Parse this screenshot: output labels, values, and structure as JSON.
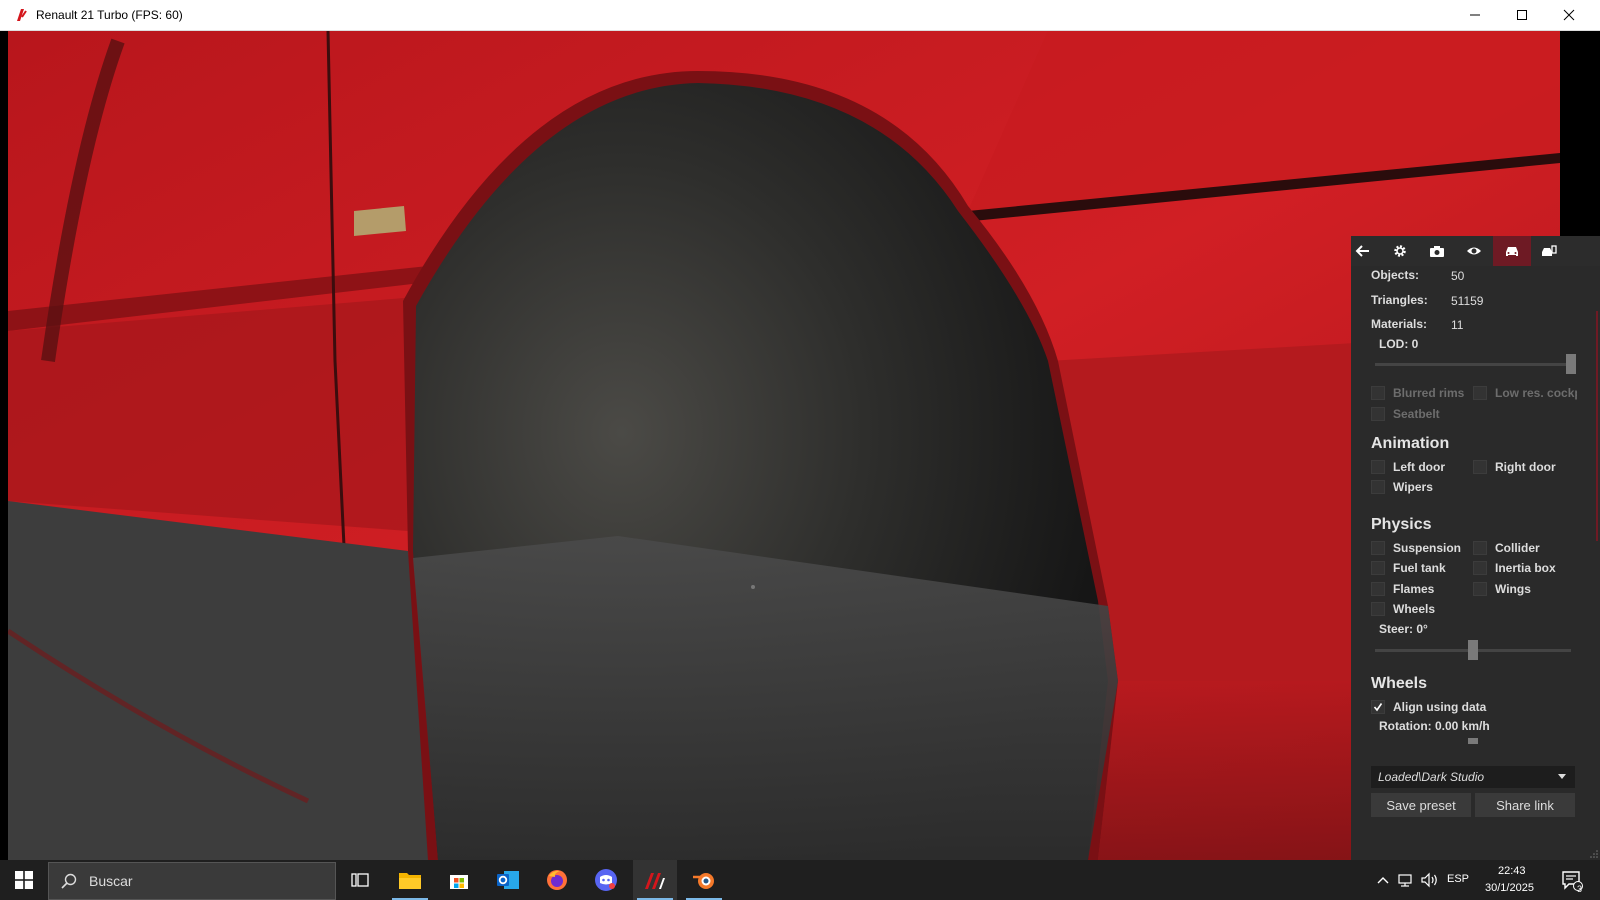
{
  "window": {
    "title": "Renault 21 Turbo (FPS: 60)",
    "controls": [
      "minimize",
      "maximize",
      "close"
    ]
  },
  "panel": {
    "tabs": [
      "back-arrow-icon",
      "gear-icon",
      "camera-icon",
      "eye-icon",
      "car-icon",
      "car-info-icon"
    ],
    "active_tab": "car-icon",
    "stats": [
      {
        "label": "Objects:",
        "value": "50"
      },
      {
        "label": "Triangles:",
        "value": "51159"
      },
      {
        "label": "Materials:",
        "value": "11"
      }
    ],
    "lod_label": "LOD: 0",
    "options": {
      "blurred_rims": "Blurred rims",
      "low_res_cockpit": "Low res. cockp",
      "seatbelt": "Seatbelt"
    },
    "animation": {
      "title": "Animation",
      "left_door": "Left door",
      "right_door": "Right door",
      "wipers": "Wipers"
    },
    "physics": {
      "title": "Physics",
      "suspension": "Suspension",
      "collider": "Collider",
      "fuel_tank": "Fuel tank",
      "inertia_box": "Inertia box",
      "flames": "Flames",
      "wings": "Wings",
      "wheels": "Wheels",
      "steer_label": "Steer: 0°"
    },
    "wheels": {
      "title": "Wheels",
      "align_using_data": "Align using data",
      "rotation_label": "Rotation: 0.00 km/h",
      "align_checked": true
    },
    "preset": {
      "selected": "Loaded\\Dark Studio"
    },
    "buttons": {
      "save": "Save preset",
      "share": "Share link"
    }
  },
  "taskbar": {
    "search_placeholder": "Buscar",
    "apps": [
      "task-view-icon",
      "file-explorer-icon",
      "microsoft-store-icon",
      "outlook-icon",
      "firefox-icon",
      "discord-icon",
      "content-manager-icon",
      "blender-icon"
    ],
    "tray": {
      "language": "ESP",
      "time": "22:43",
      "date": "30/1/2025",
      "notification_count": "3"
    }
  },
  "colors": {
    "accent": "#6e1a24",
    "car_red": "#c8191e",
    "panel_bg": "#2a2a2a"
  }
}
